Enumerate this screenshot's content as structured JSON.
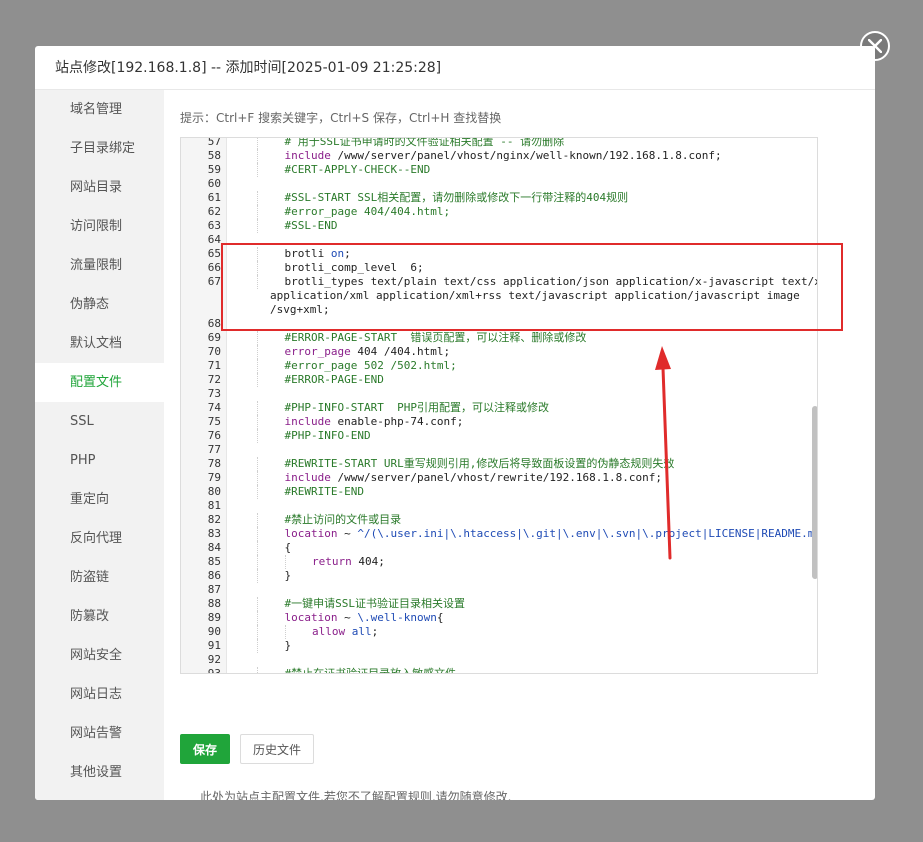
{
  "dialog": {
    "title": "站点修改[192.168.1.8] -- 添加时间[2025-01-09 21:25:28]"
  },
  "sidebar": {
    "items": [
      {
        "label": "域名管理"
      },
      {
        "label": "子目录绑定"
      },
      {
        "label": "网站目录"
      },
      {
        "label": "访问限制"
      },
      {
        "label": "流量限制"
      },
      {
        "label": "伪静态"
      },
      {
        "label": "默认文档"
      },
      {
        "label": "配置文件",
        "active": true
      },
      {
        "label": "SSL"
      },
      {
        "label": "PHP"
      },
      {
        "label": "重定向"
      },
      {
        "label": "反向代理"
      },
      {
        "label": "防盗链"
      },
      {
        "label": "防篡改"
      },
      {
        "label": "网站安全"
      },
      {
        "label": "网站日志"
      },
      {
        "label": "网站告警"
      },
      {
        "label": "其他设置"
      }
    ]
  },
  "main": {
    "hint": "提示：Ctrl+F 搜索关键字，Ctrl+S 保存，Ctrl+H 查找替换",
    "save_label": "保存",
    "history_label": "历史文件",
    "note": "此处为站点主配置文件,若您不了解配置规则,请勿随意修改."
  },
  "editor": {
    "lines": [
      {
        "n": "57",
        "t": "    # 用于SSL证书申请时的文件验证相关配置 -- 请勿删除"
      },
      {
        "n": "58",
        "t": "    include /www/server/panel/vhost/nginx/well-known/192.168.1.8.conf;"
      },
      {
        "n": "59",
        "t": "    #CERT-APPLY-CHECK--END"
      },
      {
        "n": "60",
        "t": ""
      },
      {
        "n": "61",
        "t": "    #SSL-START SSL相关配置，请勿删除或修改下一行带注释的404规则"
      },
      {
        "n": "62",
        "t": "    #error_page 404/404.html;"
      },
      {
        "n": "63",
        "t": "    #SSL-END"
      },
      {
        "n": "64",
        "t": ""
      },
      {
        "n": "65",
        "t": "    brotli on;"
      },
      {
        "n": "66",
        "t": "    brotli_comp_level  6;"
      },
      {
        "n": "67",
        "t": "    brotli_types text/plain text/css application/json application/x-javascript text/xml"
      },
      {
        "n": "",
        "t": "application/xml application/xml+rss text/javascript application/javascript image"
      },
      {
        "n": "",
        "t": "/svg+xml;"
      },
      {
        "n": "68",
        "t": ""
      },
      {
        "n": "69",
        "t": "    #ERROR-PAGE-START  错误页配置，可以注释、删除或修改"
      },
      {
        "n": "70",
        "t": "    error_page 404 /404.html;"
      },
      {
        "n": "71",
        "t": "    #error_page 502 /502.html;"
      },
      {
        "n": "72",
        "t": "    #ERROR-PAGE-END"
      },
      {
        "n": "73",
        "t": ""
      },
      {
        "n": "74",
        "t": "    #PHP-INFO-START  PHP引用配置，可以注释或修改"
      },
      {
        "n": "75",
        "t": "    include enable-php-74.conf;"
      },
      {
        "n": "76",
        "t": "    #PHP-INFO-END"
      },
      {
        "n": "77",
        "t": ""
      },
      {
        "n": "78",
        "t": "    #REWRITE-START URL重写规则引用,修改后将导致面板设置的伪静态规则失效"
      },
      {
        "n": "79",
        "t": "    include /www/server/panel/vhost/rewrite/192.168.1.8.conf;"
      },
      {
        "n": "80",
        "t": "    #REWRITE-END"
      },
      {
        "n": "81",
        "t": ""
      },
      {
        "n": "82",
        "t": "    #禁止访问的文件或目录"
      },
      {
        "n": "83",
        "t": "    location ~ ^/(\\.user.ini|\\.htaccess|\\.git|\\.env|\\.svn|\\.project|LICENSE|README.md)"
      },
      {
        "n": "84",
        "t": "    {"
      },
      {
        "n": "85",
        "t": "        return 404;"
      },
      {
        "n": "86",
        "t": "    }"
      },
      {
        "n": "87",
        "t": ""
      },
      {
        "n": "88",
        "t": "    #一键申请SSL证书验证目录相关设置"
      },
      {
        "n": "89",
        "t": "    location ~ \\.well-known{"
      },
      {
        "n": "90",
        "t": "        allow all;"
      },
      {
        "n": "91",
        "t": "    }"
      },
      {
        "n": "92",
        "t": ""
      },
      {
        "n": "93",
        "t": "    #禁止在证书验证目录放入敏感文件"
      }
    ]
  },
  "colors": {
    "accent": "#20a53a",
    "annotation": "#e02b2b"
  },
  "icons": {
    "close": "close-icon"
  }
}
